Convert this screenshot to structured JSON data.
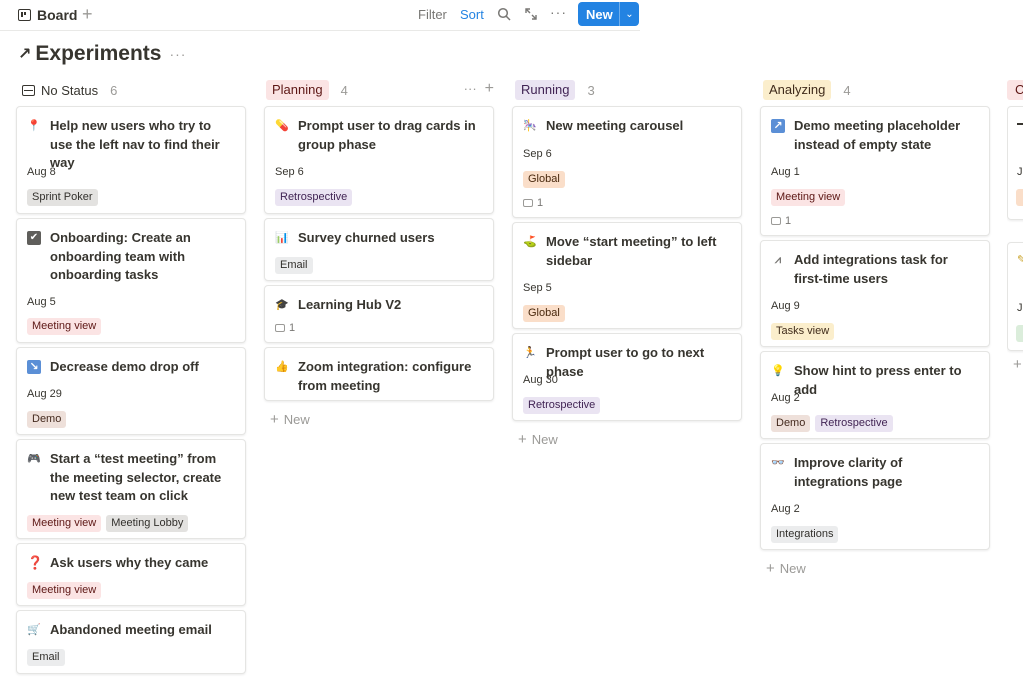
{
  "toolbar": {
    "view_tab": "Board",
    "add_view": "+",
    "filter": "Filter",
    "sort": "Sort",
    "more": "···",
    "new_label": "New"
  },
  "database": {
    "title": "Experiments",
    "arrow": "↗",
    "more": "···"
  },
  "columns": [
    {
      "name": "No Status",
      "count": "6",
      "color": "#37352f"
    },
    {
      "name": "Planning",
      "count": "4",
      "pill_bg": "#fbe4e4",
      "pill_fg": "#5d1715",
      "more": "···",
      "add": "+"
    },
    {
      "name": "Running",
      "count": "3",
      "pill_bg": "#eae4f2",
      "pill_fg": "#412454"
    },
    {
      "name": "Analyzing",
      "count": "4",
      "pill_bg": "#fbeecc",
      "pill_fg": "#402c1b"
    },
    {
      "name": "C",
      "pill_bg": "#fbe4e4"
    }
  ],
  "tag_colors": {
    "Sprint Poker": [
      "#e3e2e0",
      "#32302c"
    ],
    "Meeting view": [
      "#fbe4e4",
      "#5d1715"
    ],
    "Demo": [
      "#eee0da",
      "#442a1e"
    ],
    "Meeting Lobby": [
      "#e3e2e0",
      "#32302c"
    ],
    "Email": [
      "#ebeced",
      "#32302c"
    ],
    "Retrospective": [
      "#eae4f2",
      "#412454"
    ],
    "Global": [
      "#fadec9",
      "#49290e"
    ],
    "Tasks view": [
      "#fbeecc",
      "#402c1b"
    ],
    "Integrations": [
      "#ebeced",
      "#32302c"
    ]
  },
  "cards": {
    "c1": {
      "icon": "pin-icon",
      "glyph": "📍",
      "title": "Help new users who try to use the left nav to find their way",
      "date": "Aug 8",
      "tags": [
        "Sprint Poker"
      ]
    },
    "c2": {
      "icon": "checkbox-icon",
      "glyph": "✔",
      "title": "Onboarding: Create an onboarding team with onboarding tasks",
      "date": "Aug 5",
      "tags": [
        "Meeting view"
      ]
    },
    "c3": {
      "icon": "arrow-down-right-icon",
      "glyph": "↘",
      "title": "Decrease demo drop off",
      "date": "Aug 29",
      "tags": [
        "Demo"
      ]
    },
    "c4": {
      "icon": "gamepad-icon",
      "glyph": "🎮",
      "title": "Start a “test meeting” from the meeting selector, create new test team on click",
      "tags": [
        "Meeting view",
        "Meeting Lobby"
      ]
    },
    "c5": {
      "icon": "question-icon",
      "glyph": "❓",
      "title": "Ask users why they came",
      "tags": [
        "Meeting view"
      ]
    },
    "c6": {
      "icon": "cart-icon",
      "glyph": "🛒",
      "title": "Abandoned meeting email",
      "tags": [
        "Email"
      ]
    },
    "p1": {
      "icon": "pill-icon",
      "glyph": "💊",
      "title": "Prompt user to drag cards in group phase",
      "date": "Sep 6",
      "tags": [
        "Retrospective"
      ]
    },
    "p2": {
      "icon": "bar-chart-icon",
      "glyph": "📊",
      "title": "Survey churned users",
      "tags": [
        "Email"
      ]
    },
    "p3": {
      "icon": "graduation-cap-icon",
      "glyph": "🎓",
      "title": "Learning Hub V2",
      "comments": "1"
    },
    "p4": {
      "icon": "thumbs-up-icon",
      "glyph": "👍",
      "title": "Zoom integration: configure from meeting"
    },
    "r1": {
      "icon": "carousel-icon",
      "glyph": "🎠",
      "title": "New meeting carousel",
      "date": "Sep 6",
      "tags": [
        "Global"
      ],
      "comments": "1"
    },
    "r2": {
      "icon": "golf-flag-icon",
      "glyph": "⛳",
      "title": "Move “start meeting” to left sidebar",
      "date": "Sep 5",
      "tags": [
        "Global"
      ]
    },
    "r3": {
      "icon": "runner-icon",
      "glyph": "🏃",
      "title": "Prompt user to go to next phase",
      "date": "Aug 30",
      "tags": [
        "Retrospective"
      ]
    },
    "a1": {
      "icon": "arrow-up-right-icon",
      "glyph": "↗",
      "title": "Demo meeting placeholder instead of empty state",
      "date": "Aug 1",
      "tags": [
        "Meeting view"
      ],
      "comments": "1"
    },
    "a2": {
      "icon": "integrations-icon",
      "glyph": "⩘",
      "title": "Add integrations task for first-time users",
      "date": "Aug 9",
      "tags": [
        "Tasks view"
      ]
    },
    "a3": {
      "icon": "lightbulb-icon",
      "glyph": "💡",
      "title": "Show hint to press enter to add",
      "date": "Aug 2",
      "tags": [
        "Demo",
        "Retrospective"
      ]
    },
    "a4": {
      "icon": "glasses-icon",
      "glyph": "👓",
      "title": "Improve clarity of integrations page",
      "date": "Aug 2",
      "tags": [
        "Integrations"
      ]
    }
  },
  "partial": {
    "date1": "J",
    "date2": "J"
  },
  "new_label": "New"
}
